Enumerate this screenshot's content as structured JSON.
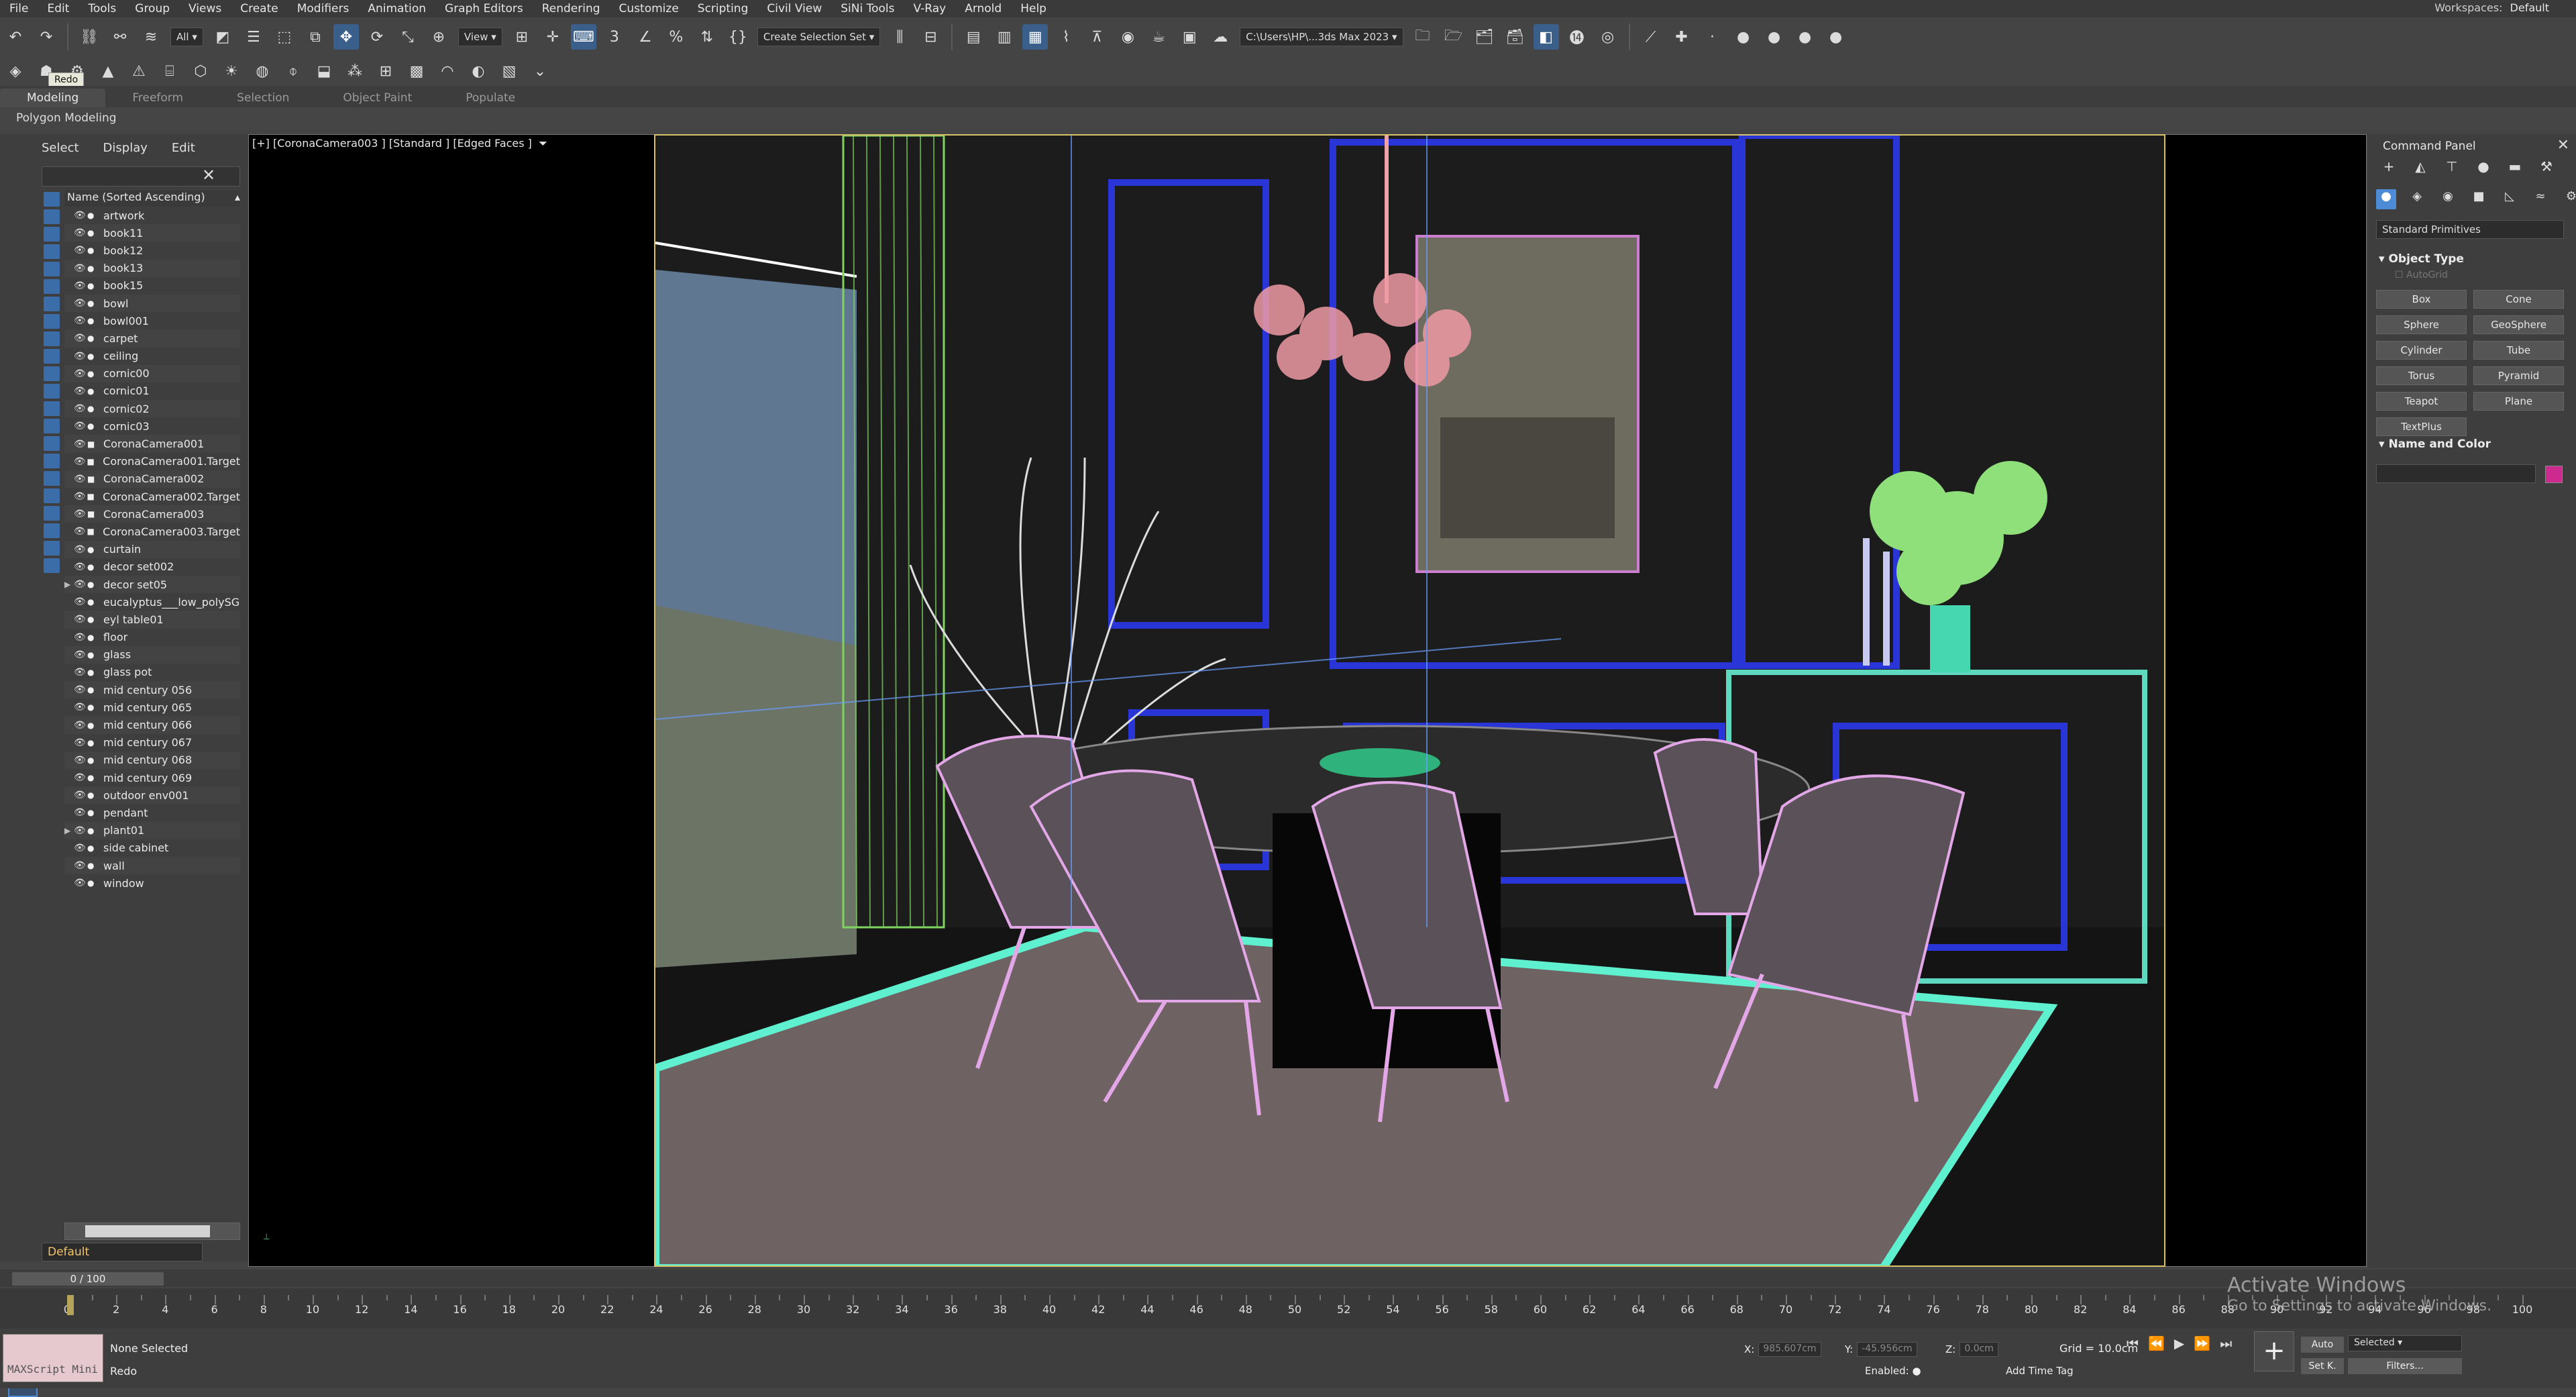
{
  "menubar": {
    "items": [
      "File",
      "Edit",
      "Tools",
      "Group",
      "Views",
      "Create",
      "Modifiers",
      "Animation",
      "Graph Editors",
      "Rendering",
      "Customize",
      "Scripting",
      "Civil View",
      "SiNi Tools",
      "V-Ray",
      "Arnold",
      "Help"
    ],
    "workspace_label": "Workspaces:",
    "workspace_value": "Default"
  },
  "toolbar": {
    "filter_all": "All",
    "view_dd": "View",
    "selection_set": "Create Selection Set",
    "project_path": "C:\\Users\\HP\\...3ds Max 2023",
    "redo_tooltip": "Redo"
  },
  "ribbon": {
    "tabs": [
      "Modeling",
      "Freeform",
      "Selection",
      "Object Paint",
      "Populate"
    ],
    "active_tab": "Modeling",
    "panel_label": "Polygon Modeling"
  },
  "explorer": {
    "tabs": [
      "Select",
      "Display",
      "Edit"
    ],
    "header": "Name (Sorted Ascending)",
    "items": [
      "artwork",
      "book11",
      "book12",
      "book13",
      "book15",
      "bowl",
      "bowl001",
      "carpet",
      "ceiling",
      "cornic00",
      "cornic01",
      "cornic02",
      "cornic03",
      "CoronaCamera001",
      "CoronaCamera001.Target",
      "CoronaCamera002",
      "CoronaCamera002.Target",
      "CoronaCamera003",
      "CoronaCamera003.Target",
      "curtain",
      "decor set002",
      "decor set05",
      "eucalyptus___low_polySG",
      "eyl table01",
      "floor",
      "glass",
      "glass pot",
      "mid century 056",
      "mid century 065",
      "mid century 066",
      "mid century 067",
      "mid century 068",
      "mid century 069",
      "outdoor env001",
      "pendant",
      "plant01",
      "side cabinet",
      "wall",
      "window"
    ],
    "layer": "Default"
  },
  "viewport": {
    "label": "[+] [CoronaCamera003 ] [Standard ] [Edged Faces ]"
  },
  "command_panel": {
    "title": "Command Panel",
    "category": "Standard Primitives",
    "object_type_label": "Object Type",
    "autogrid": "AutoGrid",
    "buttons": [
      "Box",
      "Cone",
      "Sphere",
      "GeoSphere",
      "Cylinder",
      "Tube",
      "Torus",
      "Pyramid",
      "Teapot",
      "Plane",
      "TextPlus"
    ],
    "name_color_label": "Name and Color",
    "color": "#cc2a8e"
  },
  "timeline": {
    "frame_display": "0 / 100",
    "labels": [
      "0",
      "2",
      "4",
      "6",
      "8",
      "10",
      "12",
      "14",
      "16",
      "18",
      "20",
      "22",
      "24",
      "26",
      "28",
      "30",
      "32",
      "34",
      "36",
      "38",
      "40",
      "42",
      "44",
      "46",
      "48",
      "50",
      "52",
      "54",
      "56",
      "58",
      "60",
      "62",
      "64",
      "66",
      "68",
      "70",
      "72",
      "74",
      "76",
      "78",
      "80",
      "82",
      "84",
      "86",
      "88",
      "90",
      "92",
      "94",
      "96",
      "98",
      "100"
    ]
  },
  "status": {
    "maxscript": "MAXScript Mini",
    "selection": "None Selected",
    "last_action": "Redo",
    "x_label": "X:",
    "x_value": "985.607cm",
    "y_label": "Y:",
    "y_value": "-45.956cm",
    "z_label": "Z:",
    "z_value": "0.0cm",
    "grid": "Grid = 10.0cm",
    "enabled": "Enabled:",
    "add_time_tag": "Add Time Tag",
    "auto": "Auto",
    "set_key": "Set K.",
    "selected": "Selected",
    "filters": "Filters...",
    "frame_spinner": "0"
  },
  "watermark": {
    "title": "Activate Windows",
    "subtitle": "Go to Settings to activate Windows."
  }
}
